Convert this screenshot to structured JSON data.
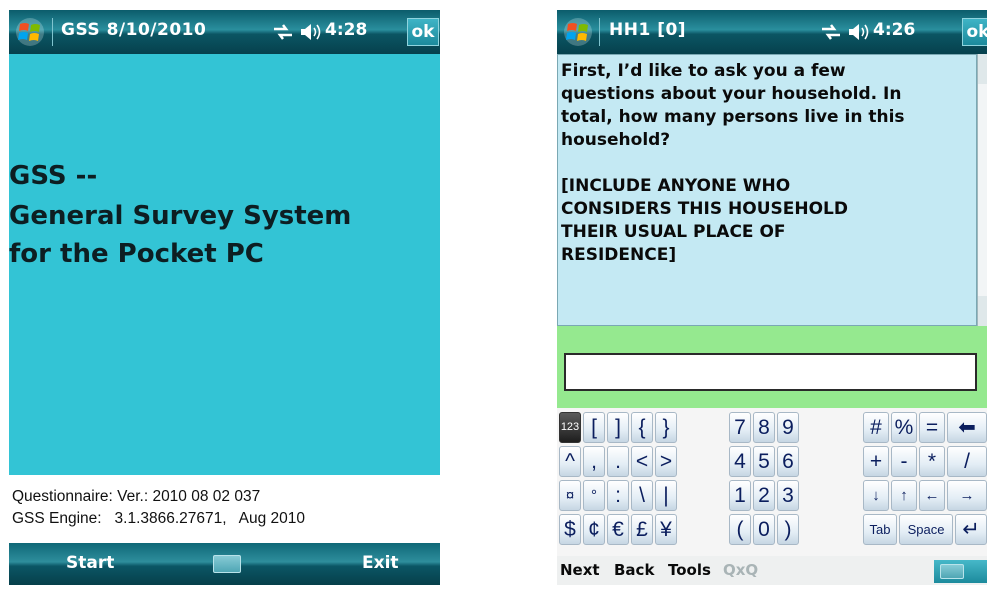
{
  "left_screen": {
    "title": "GSS  8/10/2010",
    "time": "4:28",
    "ok_label": "ok",
    "splash_lines": [
      "GSS --",
      "General Survey System",
      "for the Pocket PC"
    ],
    "version_lines": [
      "Questionnaire: Ver.: 2010 08 02 037",
      "GSS Engine:   3.1.3866.27671,   Aug 2010"
    ],
    "softkeys": {
      "left": "Start",
      "right": "Exit"
    }
  },
  "right_screen": {
    "title": "HH1 [0]",
    "time": "4:26",
    "ok_label": "ok",
    "question_lines": [
      "First, I’d like to ask you a few",
      "questions about your household.  In",
      "total, how many persons live in this",
      "household?",
      "",
      "[INCLUDE ANYONE WHO",
      "CONSIDERS THIS HOUSEHOLD",
      "THEIR USUAL PLACE OF",
      "RESIDENCE]"
    ],
    "answer": {
      "value": "",
      "placeholder": ""
    },
    "keypad": {
      "row1": [
        "123",
        "[",
        "]",
        "{",
        "}",
        "7",
        "8",
        "9",
        "#",
        "%",
        "=",
        "⬅"
      ],
      "row2": [
        "^",
        ",",
        ".",
        "<",
        ">",
        "4",
        "5",
        "6",
        "+",
        "-",
        "*",
        "/"
      ],
      "row3": [
        "¤",
        "°",
        ":",
        "\\",
        "|",
        "1",
        "2",
        "3",
        "↓",
        "↑",
        "←",
        "→"
      ],
      "row4": [
        "$",
        "¢",
        "€",
        "£",
        "¥",
        "(",
        "0",
        ")",
        "Tab",
        "Space",
        "↵"
      ]
    },
    "menu": [
      "Next",
      "Back",
      "Tools",
      "QxQ"
    ]
  },
  "colors": {
    "title_bar": "#0b5c6b",
    "splash_bg": "#33c4d5",
    "question_bg": "#c4e9f3",
    "answer_bg": "#95e98f",
    "key_text": "#0b1e5e"
  },
  "icons": [
    "windows-start-icon",
    "connectivity-icon",
    "volume-icon",
    "keyboard-icon"
  ]
}
